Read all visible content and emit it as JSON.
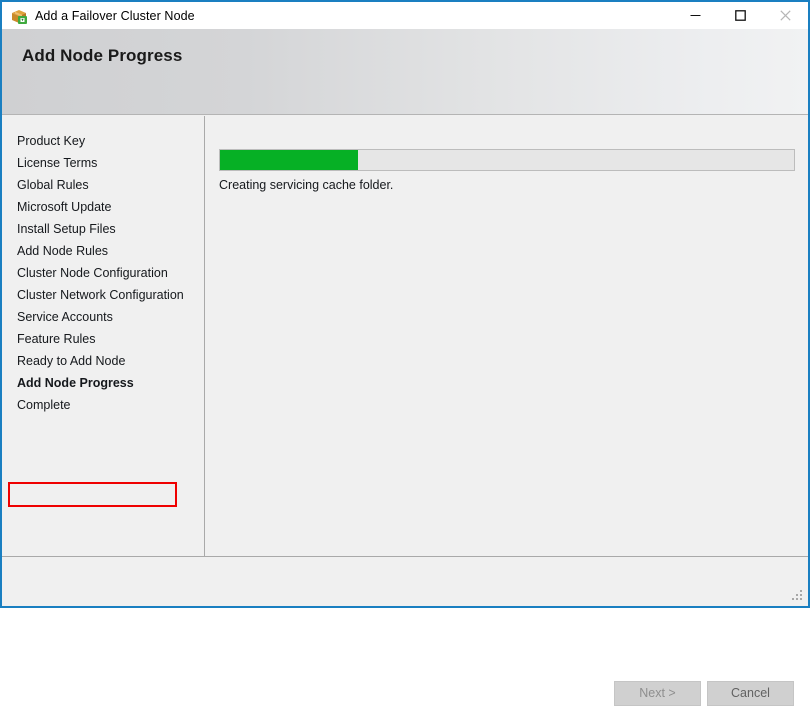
{
  "window": {
    "title": "Add a Failover Cluster Node",
    "icon": "setup-package-icon",
    "controls": {
      "minimize": "minimize-icon",
      "maximize": "maximize-icon",
      "close": "close-icon"
    },
    "accent_border_color": "#1a7fc1"
  },
  "banner": {
    "title": "Add Node Progress"
  },
  "sidebar": {
    "items": [
      {
        "label": "Product Key",
        "current": false
      },
      {
        "label": "License Terms",
        "current": false
      },
      {
        "label": "Global Rules",
        "current": false
      },
      {
        "label": "Microsoft Update",
        "current": false
      },
      {
        "label": "Install Setup Files",
        "current": false
      },
      {
        "label": "Add Node Rules",
        "current": false
      },
      {
        "label": "Cluster Node Configuration",
        "current": false
      },
      {
        "label": "Cluster Network Configuration",
        "current": false
      },
      {
        "label": "Service Accounts",
        "current": false
      },
      {
        "label": "Feature Rules",
        "current": false
      },
      {
        "label": "Ready to Add Node",
        "current": false
      },
      {
        "label": "Add Node Progress",
        "current": true
      },
      {
        "label": "Complete",
        "current": false
      }
    ],
    "highlight_color": "#ef0000",
    "highlighted_item": "Add Node Progress"
  },
  "content": {
    "progress": {
      "percent": 24,
      "fill_color": "#06b025",
      "track_color": "#e6e6e6"
    },
    "status_text": "Creating servicing cache folder."
  },
  "footer": {
    "next_label": "Next >",
    "next_enabled": false,
    "cancel_label": "Cancel",
    "cancel_enabled": true,
    "resize_grip": "resize-grip-icon"
  }
}
